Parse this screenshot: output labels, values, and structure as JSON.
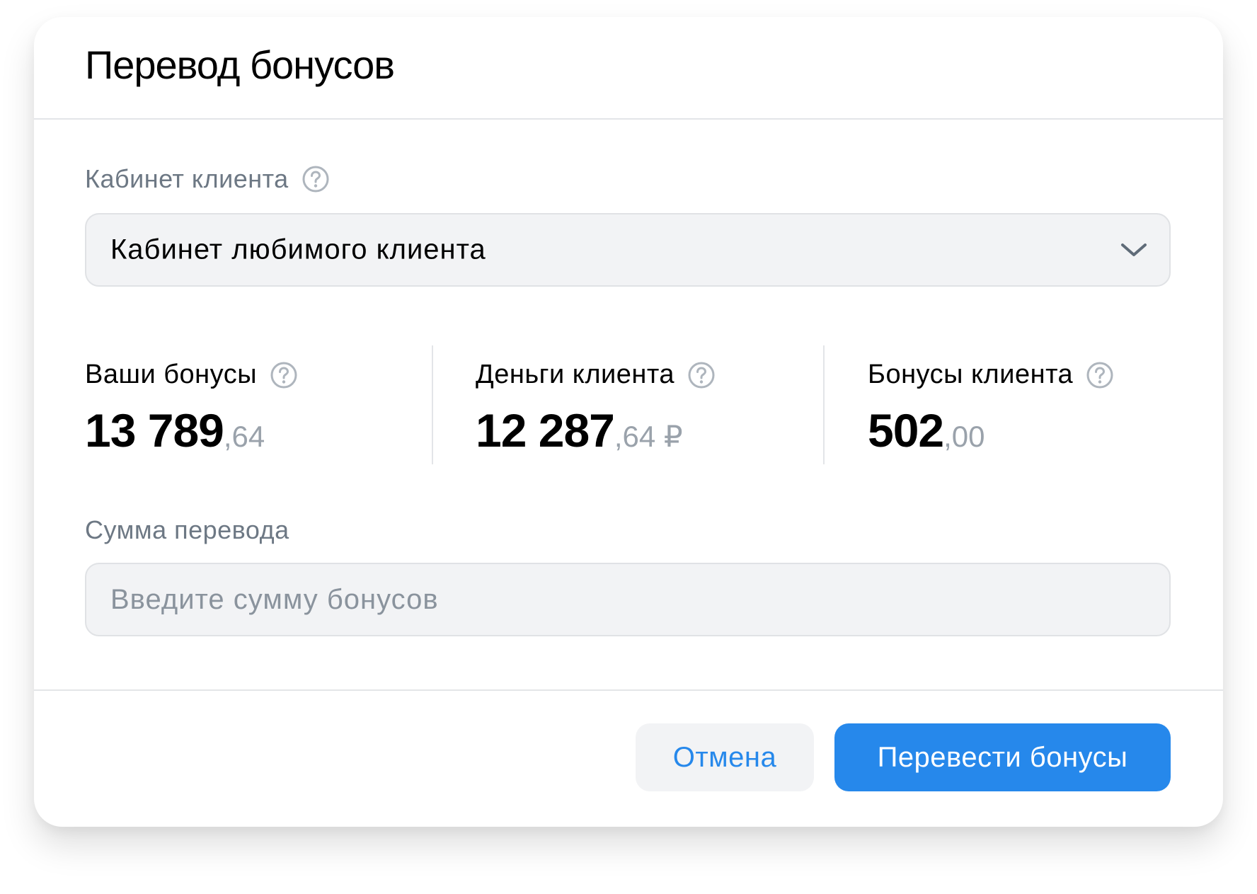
{
  "dialog": {
    "title": "Перевод бонусов"
  },
  "cabinet": {
    "label": "Кабинет клиента",
    "selected_value": "Кабинет любимого клиента"
  },
  "stats": [
    {
      "label": "Ваши бонусы",
      "int": "13 789",
      "frac": ",64"
    },
    {
      "label": "Деньги клиента",
      "int": "12 287",
      "frac": ",64 ₽"
    },
    {
      "label": "Бонусы клиента",
      "int": "502",
      "frac": ",00"
    }
  ],
  "amount": {
    "label": "Сумма перевода",
    "placeholder": "Введите сумму бонусов",
    "value": ""
  },
  "actions": {
    "cancel_label": "Отмена",
    "submit_label": "Перевести бонусы"
  },
  "icons": {
    "help": "help-circle-icon",
    "dropdown": "chevron-down-icon"
  },
  "colors": {
    "accent": "#2688eb",
    "field_bg": "#f2f3f5",
    "muted_text": "#6d7884"
  }
}
